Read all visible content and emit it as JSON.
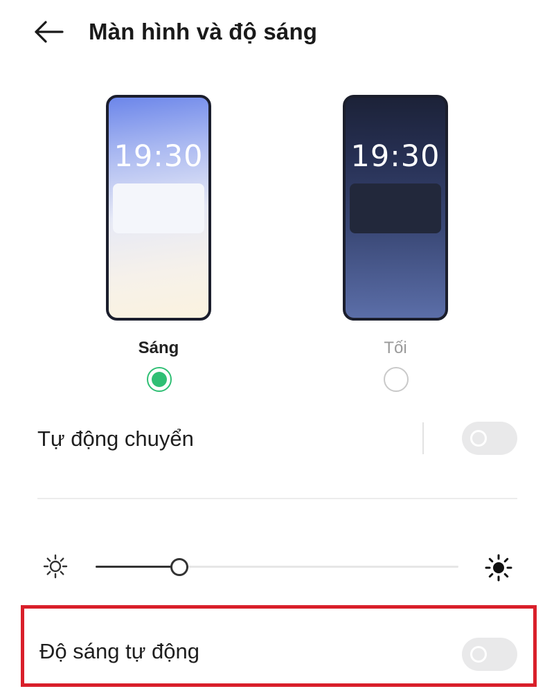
{
  "header": {
    "back_icon": "arrow-left-icon",
    "title": "Màn hình và độ sáng"
  },
  "themes": {
    "selected": "light",
    "options": [
      {
        "id": "light",
        "label": "Sáng",
        "preview_time": "19:30",
        "selected": true
      },
      {
        "id": "dark",
        "label": "Tối",
        "preview_time": "19:30",
        "selected": false
      }
    ]
  },
  "auto_switch": {
    "label": "Tự động chuyển",
    "enabled": false
  },
  "brightness": {
    "level_percent": 23,
    "low_icon": "sun-outline-icon",
    "high_icon": "sun-filled-icon"
  },
  "auto_brightness": {
    "label": "Độ sáng tự động",
    "enabled": false,
    "highlighted": true,
    "highlight_color": "#d91f2a"
  },
  "colors": {
    "accent": "#2fbf74",
    "toggle_off": "#e9e9ea"
  }
}
